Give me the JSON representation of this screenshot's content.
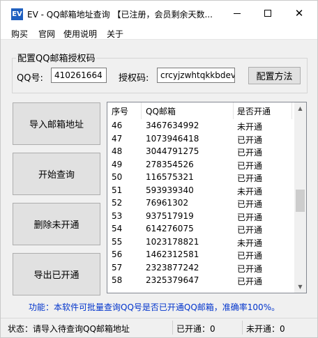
{
  "window": {
    "icon_text": "EV",
    "title": "EV - QQ邮箱地址查询 【已注册，会员剩余天数..."
  },
  "menu": [
    "购买",
    "官网",
    "使用说明",
    "关于"
  ],
  "config": {
    "group_title": "配置QQ邮箱授权码",
    "qq_label": "QQ号:",
    "qq_value": "410261664",
    "auth_label": "授权码:",
    "auth_value": "crcyjzwhtqkkbdev",
    "config_button": "配置方法"
  },
  "actions": {
    "import": "导入邮箱地址",
    "start": "开始查询",
    "delete": "删除未开通",
    "export": "导出已开通"
  },
  "table": {
    "headers": [
      "序号",
      "QQ邮箱",
      "是否开通"
    ],
    "rows": [
      [
        "46",
        "3467634992",
        "未开通"
      ],
      [
        "47",
        "1073946418",
        "已开通"
      ],
      [
        "48",
        "3044791275",
        "已开通"
      ],
      [
        "49",
        "278354526",
        "已开通"
      ],
      [
        "50",
        "116575321",
        "已开通"
      ],
      [
        "51",
        "593939340",
        "未开通"
      ],
      [
        "52",
        "76961302",
        "已开通"
      ],
      [
        "53",
        "937517919",
        "已开通"
      ],
      [
        "54",
        "614276075",
        "已开通"
      ],
      [
        "55",
        "1023178821",
        "未开通"
      ],
      [
        "56",
        "1462312581",
        "已开通"
      ],
      [
        "57",
        "2323877242",
        "已开通"
      ],
      [
        "58",
        "2325379647",
        "已开通"
      ]
    ]
  },
  "function_note": "功能：本软件可批量查询QQ号是否已开通QQ邮箱，准确率100%。",
  "status": {
    "state": "状态：请导入待查询QQ邮箱地址",
    "opened": "已开通：0",
    "not_opened": "未开通：0"
  },
  "colors": {
    "note_text": "#0033cc",
    "icon_bg": "#1f5fbf"
  }
}
